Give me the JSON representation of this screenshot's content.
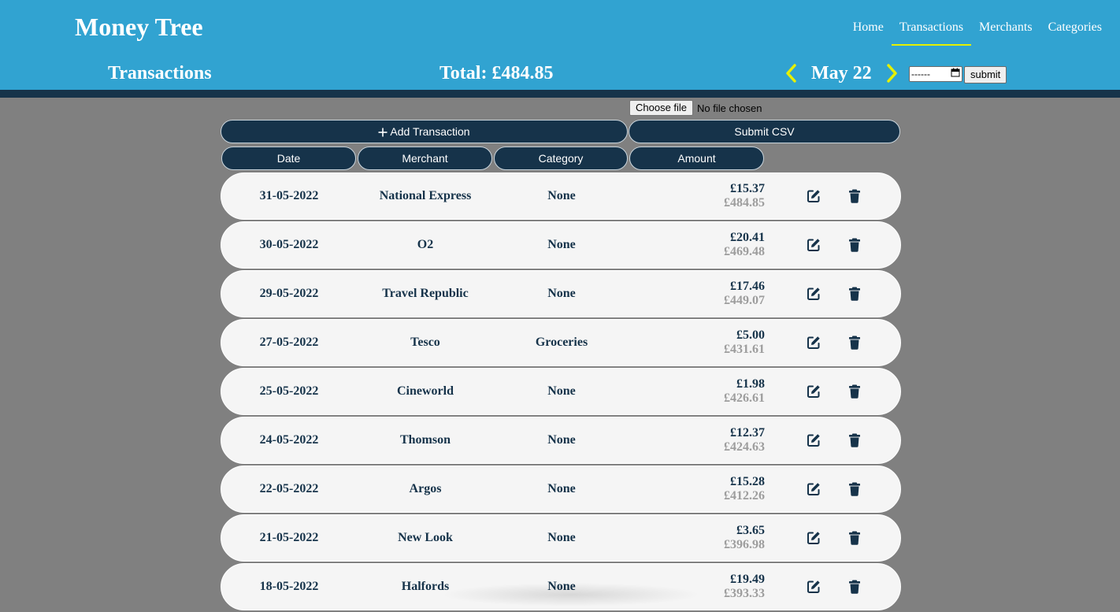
{
  "app": {
    "brand": "Money Tree"
  },
  "nav": {
    "items": [
      {
        "label": "Home"
      },
      {
        "label": "Transactions"
      },
      {
        "label": "Merchants"
      },
      {
        "label": "Categories"
      }
    ],
    "active": "Transactions"
  },
  "header": {
    "heading": "Transactions",
    "total": "Total: £484.85",
    "month": "May 22",
    "prev_icon": "chevron-left-icon",
    "next_icon": "chevron-right-icon",
    "date_input_value": "------",
    "submit_label": "submit"
  },
  "file": {
    "choose_label": "Choose file",
    "status": "No file chosen"
  },
  "actions": {
    "add_label": "Add Transaction",
    "add_icon": "plus-icon",
    "csv_label": "Submit CSV"
  },
  "columns": {
    "date": "Date",
    "merchant": "Merchant",
    "category": "Category",
    "amount": "Amount"
  },
  "transactions": [
    {
      "date": "31-05-2022",
      "merchant": "National Express",
      "category": "None",
      "amount": "£15.37",
      "running": "£484.85"
    },
    {
      "date": "30-05-2022",
      "merchant": "O2",
      "category": "None",
      "amount": "£20.41",
      "running": "£469.48"
    },
    {
      "date": "29-05-2022",
      "merchant": "Travel Republic",
      "category": "None",
      "amount": "£17.46",
      "running": "£449.07"
    },
    {
      "date": "27-05-2022",
      "merchant": "Tesco",
      "category": "Groceries",
      "amount": "£5.00",
      "running": "£431.61"
    },
    {
      "date": "25-05-2022",
      "merchant": "Cineworld",
      "category": "None",
      "amount": "£1.98",
      "running": "£426.61"
    },
    {
      "date": "24-05-2022",
      "merchant": "Thomson",
      "category": "None",
      "amount": "£12.37",
      "running": "£424.63"
    },
    {
      "date": "22-05-2022",
      "merchant": "Argos",
      "category": "None",
      "amount": "£15.28",
      "running": "£412.26"
    },
    {
      "date": "21-05-2022",
      "merchant": "New Look",
      "category": "None",
      "amount": "£3.65",
      "running": "£396.98"
    },
    {
      "date": "18-05-2022",
      "merchant": "Halfords",
      "category": "None",
      "amount": "£19.49",
      "running": "£393.33"
    }
  ],
  "colors": {
    "header_blue": "#31a3d1",
    "navy": "#16334a",
    "accent_yellow": "#e6f000",
    "page_gray": "#808080",
    "row_bg": "#f5f5f5",
    "muted_amount": "#9d9d9d"
  },
  "row_icons": {
    "edit": "edit-icon",
    "delete": "trash-icon"
  }
}
